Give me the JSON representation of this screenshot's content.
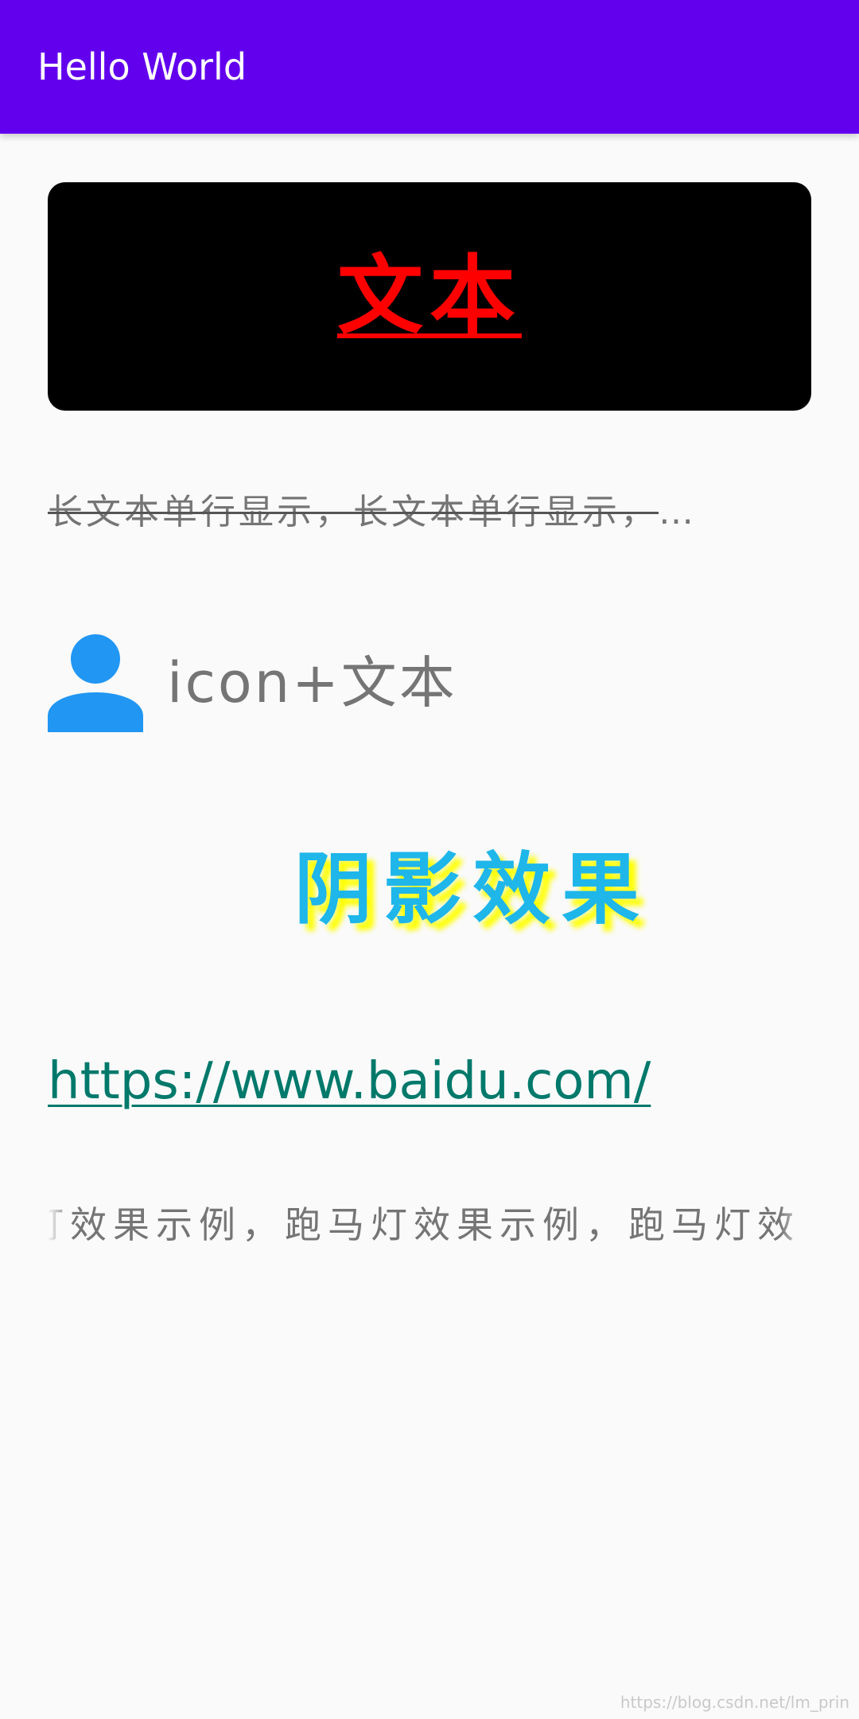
{
  "app_bar": {
    "title": "Hello World",
    "color": "#6200ee"
  },
  "card": {
    "text": "文本",
    "text_color": "#ff0000",
    "background": "#000000"
  },
  "long_text": {
    "text": "长文本单行显示，长文本单行显示，长文本单行显示，长文本单行显示"
  },
  "icon_row": {
    "icon": "person-icon",
    "icon_color": "#2196f3",
    "label": "icon+文本"
  },
  "shadow_text": {
    "text": "阴影效果",
    "color": "#1fb6ea",
    "shadow_color": "#ffff00"
  },
  "link": {
    "text": "https://www.baidu.com/",
    "color": "#00796b"
  },
  "marquee": {
    "text": "灯效果示例，跑马灯效果示例，跑马灯效"
  },
  "watermark": {
    "text": "https://blog.csdn.net/lm_prin"
  }
}
